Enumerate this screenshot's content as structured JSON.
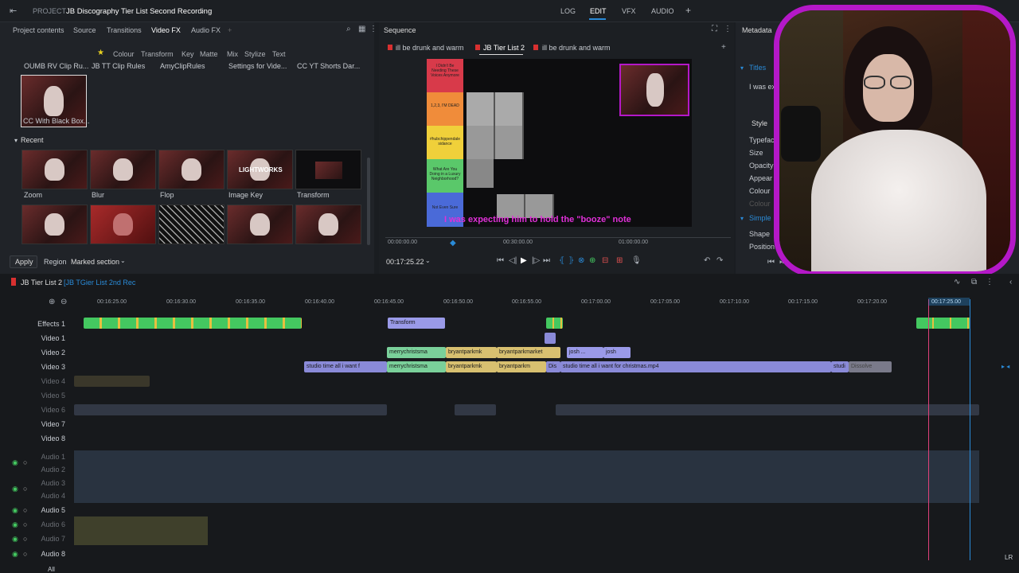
{
  "topbar": {
    "project_prefix": "PROJECT",
    "project_name": "JB Discography Tier List Second Recording",
    "tabs": [
      "LOG",
      "EDIT",
      "VFX",
      "AUDIO"
    ],
    "active_tab": "EDIT",
    "add": "+"
  },
  "left_tabs": [
    "Project contents",
    "Source",
    "Transitions",
    "Video FX",
    "Audio FX",
    "+"
  ],
  "fx_categories": [
    "Colour",
    "Transform",
    "Key",
    "Matte",
    "Mix",
    "Stylize",
    "Text"
  ],
  "fx_names": [
    "OUMB RV Clip Ru...",
    "JB TT Clip Rules",
    "AmyClipRules",
    "Settings for Vide...",
    "CC YT Shorts Dar..."
  ],
  "selected_fx": "CC With Black Box...",
  "recent_label": "Recent",
  "recent_items": [
    "Zoom",
    "Blur",
    "Flop",
    "Image Key",
    "Transform"
  ],
  "lightworks_label": "LIGHTWORKS",
  "apply_label": "Apply",
  "region_label": "Region",
  "region_value": "Marked section",
  "viewer": {
    "title": "Sequence",
    "tabs": [
      "ill be drunk and warm",
      "JB Tier List 2",
      "ill be drunk and warm"
    ],
    "subtitle": "I was expecting him to hold the \"booze\" note",
    "times": [
      "00:00:00.00",
      "00:30:00.00",
      "01:00:00.00"
    ],
    "current_time": "00:17:25.22",
    "tier_labels": [
      "I Didn't Be Needing These Voices Anymore",
      "1,2,3, I'M DEAD",
      "#hubchippendale sidance",
      "What Are You Doing in a Luxury Neighborhood?",
      "Not Even Sure"
    ],
    "tier_colors": [
      "#d83a4a",
      "#f08c3a",
      "#f0d03a",
      "#5ac86a",
      "#4a6ad8"
    ]
  },
  "meta": {
    "title": "Metadata",
    "sec_titles": "Titles",
    "titles_value": "I was ex",
    "style_tab": "Style",
    "props": [
      "Typeface",
      "Size",
      "Opacity",
      "Appear",
      "Colour",
      "Colour"
    ],
    "sec_simple": "Simple",
    "props2": [
      "Shape",
      "Position"
    ]
  },
  "timeline": {
    "seq_name": "JB Tier List 2",
    "seq_sub": "[JB TGier List 2nd Rec",
    "ruler": [
      "00:16:25.00",
      "00:16:30.00",
      "00:16:35.00",
      "00:16:40.00",
      "00:16:45.00",
      "00:16:50.00",
      "00:16:55.00",
      "00:17:00.00",
      "00:17:05.00",
      "00:17:10.00",
      "00:17:15.00",
      "00:17:20.00",
      "00:17:25.00"
    ],
    "tracks": [
      "Effects 1",
      "Video 1",
      "Video 2",
      "Video 3",
      "Video 4",
      "Video 5",
      "Video 6",
      "Video 7",
      "Video 8",
      "Audio 1",
      "Audio 2",
      "Audio 3",
      "Audio 4",
      "Audio 5",
      "Audio 6",
      "Audio 7",
      "Audio 8"
    ],
    "clips": {
      "transform": "Transform",
      "merry1": "merrychristsma",
      "bryant1": "bryantparkmk",
      "bryant2": "bryantparkmarket",
      "josh1": "josh ...",
      "josh2": "josh",
      "studio1": "studio time all i want f",
      "merry2": "merrychristsma",
      "bryant3": "bryantparkmk",
      "bryant4": "bryantparkm",
      "studio2": "studio time all i want for christmas.mp4",
      "dissolve": "Dissolve",
      "dis": "Dis",
      "studi": "studi"
    },
    "all_label": "All",
    "lr_label": "LR"
  },
  "colors": {
    "accent": "#2a8bd8",
    "green_clip": "#44c860",
    "yellow_clip": "#e8c040",
    "purple_clip": "#8a8ad8",
    "webcam_border": "#b418c8",
    "playhead": "#e0407a"
  }
}
